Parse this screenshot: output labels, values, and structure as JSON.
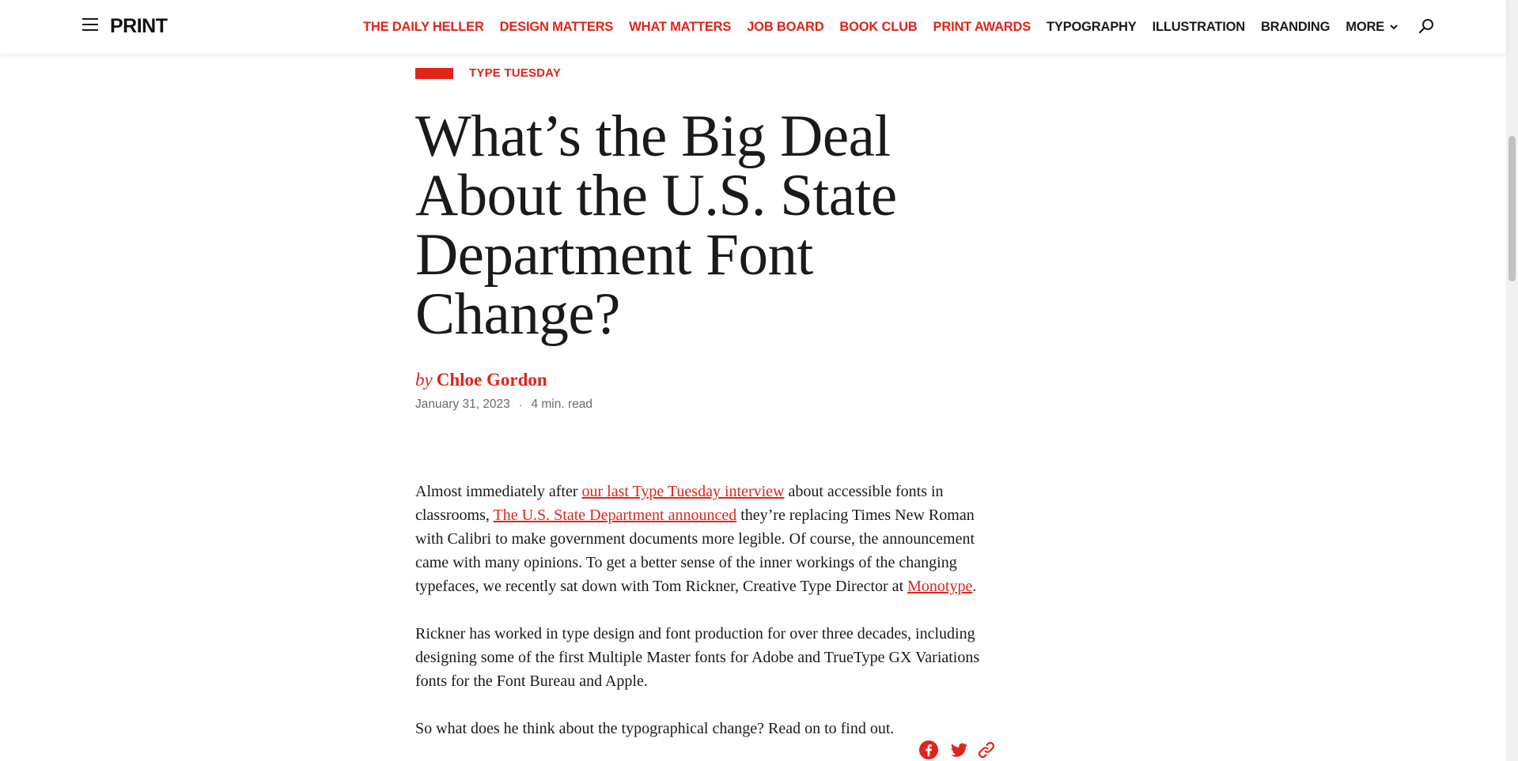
{
  "header": {
    "logo": "PRINT",
    "nav": [
      {
        "label": "THE DAILY HELLER",
        "style": "red"
      },
      {
        "label": "DESIGN MATTERS",
        "style": "red"
      },
      {
        "label": "WHAT MATTERS",
        "style": "red"
      },
      {
        "label": "JOB BOARD",
        "style": "red"
      },
      {
        "label": "BOOK CLUB",
        "style": "red"
      },
      {
        "label": "PRINT AWARDS",
        "style": "red"
      },
      {
        "label": "TYPOGRAPHY",
        "style": "dark"
      },
      {
        "label": "ILLUSTRATION",
        "style": "dark"
      },
      {
        "label": "BRANDING",
        "style": "dark"
      }
    ],
    "more_label": "MORE"
  },
  "article": {
    "category": "TYPE TUESDAY",
    "title": "What’s the Big Deal About the U.S. State Department Font Change?",
    "by": "by",
    "author": "Chloe Gordon",
    "date": "January 31, 2023",
    "separator": "·",
    "read_time": "4 min. read",
    "paragraphs": {
      "p1": {
        "t1": "Almost immediately after ",
        "link1": "our last Type Tuesday interview",
        "t2": " about accessible fonts in classrooms, ",
        "link2": "The U.S. State Department announced",
        "t3": " they’re replacing Times New Roman with Calibri to make government documents more legible. Of course, the announcement came with many opinions. To get a better sense of the inner workings of the changing typefaces, we recently sat down with Tom Rickner, Creative Type Director at ",
        "link3": "Monotype",
        "t4": "."
      },
      "p2": "Rickner has worked in type design and font production for over three decades, including designing some of the first Multiple Master fonts for Adobe and TrueType GX Variations fonts for the Font Bureau and Apple.",
      "p3": "So what does he think about the typographical change? Read on to find out."
    }
  },
  "share": {
    "icons": [
      "facebook-icon",
      "twitter-icon",
      "link-icon"
    ]
  },
  "colors": {
    "accent": "#e0241b",
    "text": "#1a1a1a",
    "meta": "#6b6b6b"
  }
}
